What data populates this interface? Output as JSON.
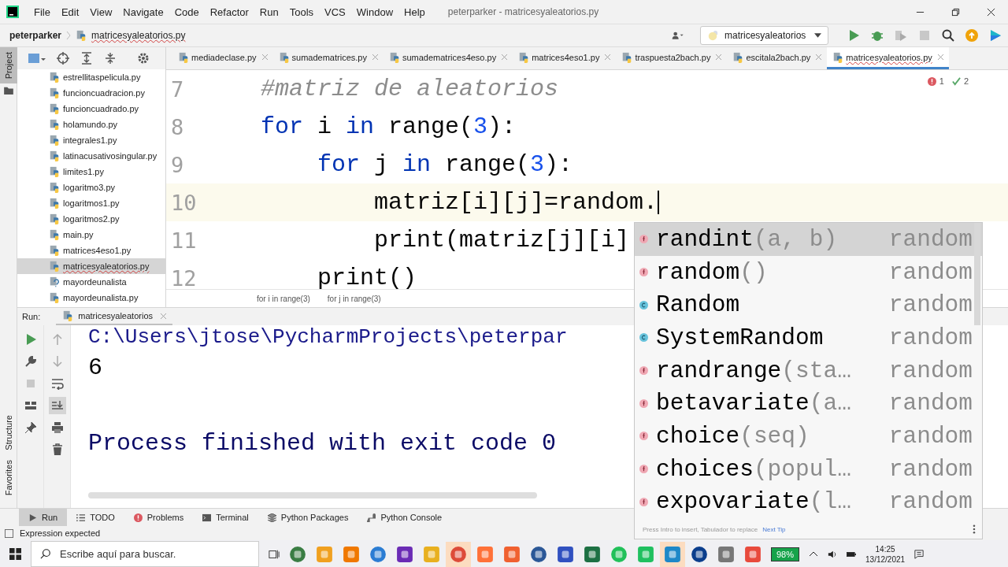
{
  "window": {
    "title": "peterparker - matricesyaleatorios.py",
    "menu": [
      "File",
      "Edit",
      "View",
      "Navigate",
      "Code",
      "Refactor",
      "Run",
      "Tools",
      "VCS",
      "Window",
      "Help"
    ]
  },
  "navbar": {
    "project": "peterparker",
    "file": "matricesyaleatorios.py",
    "run_config": "matricesyaleatorios"
  },
  "project_panel": {
    "tab": "Project",
    "files": [
      {
        "name": "estrellitaspelicula.py",
        "kind": "python",
        "selected": false
      },
      {
        "name": "funcioncuadracion.py",
        "kind": "python",
        "selected": false
      },
      {
        "name": "funcioncuadrado.py",
        "kind": "python",
        "selected": false
      },
      {
        "name": "holamundo.py",
        "kind": "python",
        "selected": false
      },
      {
        "name": "integrales1.py",
        "kind": "python",
        "selected": false
      },
      {
        "name": "latinacusativosingular.py",
        "kind": "python",
        "selected": false
      },
      {
        "name": "limites1.py",
        "kind": "python",
        "selected": false
      },
      {
        "name": "logaritmo3.py",
        "kind": "python",
        "selected": false
      },
      {
        "name": "logaritmos1.py",
        "kind": "python",
        "selected": false
      },
      {
        "name": "logaritmos2.py",
        "kind": "python",
        "selected": false
      },
      {
        "name": "main.py",
        "kind": "python",
        "selected": false
      },
      {
        "name": "matrices4eso1.py",
        "kind": "python",
        "selected": false
      },
      {
        "name": "matricesyaleatorios.py",
        "kind": "python",
        "selected": true
      },
      {
        "name": "mayordeunalista",
        "kind": "unknown",
        "selected": false
      },
      {
        "name": "mayordeunalista.py",
        "kind": "python",
        "selected": false
      }
    ]
  },
  "editor": {
    "tabs": [
      {
        "label": "mediadeclase.py",
        "selected": false
      },
      {
        "label": "sumadematrices.py",
        "selected": false
      },
      {
        "label": "sumadematrices4eso.py",
        "selected": false
      },
      {
        "label": "matrices4eso1.py",
        "selected": false
      },
      {
        "label": "traspuesta2bach.py",
        "selected": false
      },
      {
        "label": "escitala2bach.py",
        "selected": false
      },
      {
        "label": "matricesyaleatorios.py",
        "selected": true
      }
    ],
    "inspections": {
      "errors": "1",
      "warnings": "2"
    },
    "lines": [
      {
        "number": "7",
        "current": false,
        "tokens": [
          {
            "text": "#matriz de aleatorios",
            "kind": "comment"
          }
        ]
      },
      {
        "number": "8",
        "current": false,
        "tokens": [
          {
            "text": "for",
            "kind": "keyword"
          },
          {
            "text": " i ",
            "kind": "plain"
          },
          {
            "text": "in",
            "kind": "keyword"
          },
          {
            "text": " range(",
            "kind": "plain"
          },
          {
            "text": "3",
            "kind": "number"
          },
          {
            "text": "):",
            "kind": "plain"
          }
        ]
      },
      {
        "number": "9",
        "current": false,
        "tokens": [
          {
            "text": "    for",
            "kind": "keyword"
          },
          {
            "text": " j ",
            "kind": "plain"
          },
          {
            "text": "in",
            "kind": "keyword"
          },
          {
            "text": " range(",
            "kind": "plain"
          },
          {
            "text": "3",
            "kind": "number"
          },
          {
            "text": "):",
            "kind": "plain"
          }
        ]
      },
      {
        "number": "10",
        "current": true,
        "tokens": [
          {
            "text": "        matriz[i][j]=random.",
            "kind": "plain"
          }
        ]
      },
      {
        "number": "11",
        "current": false,
        "tokens": [
          {
            "text": "        print(matriz[j][i]",
            "kind": "plain"
          }
        ]
      },
      {
        "number": "12",
        "current": false,
        "tokens": [
          {
            "text": "    print()",
            "kind": "plain"
          }
        ]
      }
    ],
    "breadcrumbs": [
      "for i in range(3)",
      "for j in range(3)"
    ]
  },
  "run_panel": {
    "label": "Run:",
    "tab": "matricesyaleatorios",
    "output": [
      {
        "text": "C:\\Users\\jtose\\PycharmProjects\\peterpar",
        "kind": "command"
      },
      {
        "text": "6",
        "kind": "stdout"
      },
      {
        "text": "Process finished with exit code 0",
        "kind": "system"
      }
    ]
  },
  "side_tabs": [
    "Structure",
    "Favorites"
  ],
  "tool_tabs": [
    {
      "label": "Run",
      "selected": true
    },
    {
      "label": "TODO",
      "selected": false
    },
    {
      "label": "Problems",
      "selected": false
    },
    {
      "label": "Terminal",
      "selected": false
    },
    {
      "label": "Python Packages",
      "selected": false
    },
    {
      "label": "Python Console",
      "selected": false
    }
  ],
  "status": "Expression expected",
  "completion": {
    "items": [
      {
        "name": "randint",
        "params": "(a, b)",
        "module": "random",
        "kind": "function",
        "selected": true
      },
      {
        "name": "random",
        "params": "()",
        "module": "random",
        "kind": "function",
        "selected": false
      },
      {
        "name": "Random",
        "module": "random",
        "kind": "class",
        "selected": false
      },
      {
        "name": "SystemRandom",
        "module": "random",
        "kind": "class",
        "selected": false
      },
      {
        "name": "randrange",
        "params": "(sta…",
        "module": "random",
        "kind": "function",
        "selected": false
      },
      {
        "name": "betavariate",
        "params": "(a…",
        "module": "random",
        "kind": "function",
        "selected": false
      },
      {
        "name": "choice",
        "params": "(seq)",
        "module": "random",
        "kind": "function",
        "selected": false
      },
      {
        "name": "choices",
        "params": "(popul…",
        "module": "random",
        "kind": "function",
        "selected": false
      },
      {
        "name": "expovariate",
        "params": "(l…",
        "module": "random",
        "kind": "function",
        "selected": false
      }
    ],
    "hint": "Press Intro to insert, Tabulador to replace",
    "next_tip": "Next Tip"
  },
  "taskbar": {
    "search_placeholder": "Escribe aquí para buscar.",
    "battery": "98%",
    "time": "14:25",
    "date": "13/12/2021"
  }
}
